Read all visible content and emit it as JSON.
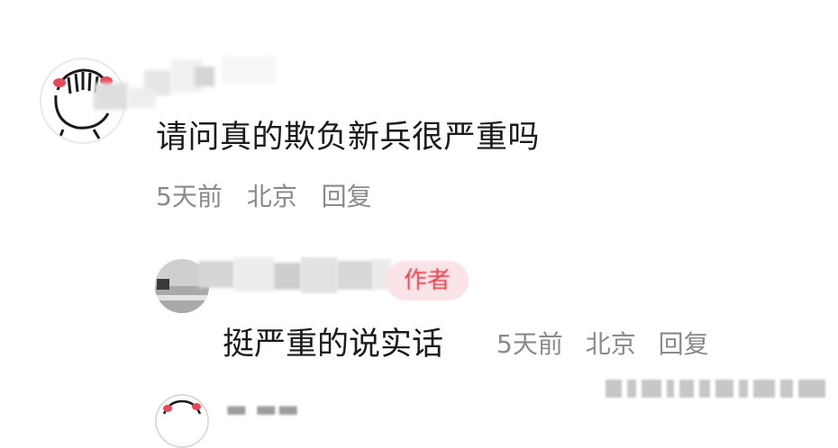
{
  "comment": {
    "text": "请问真的欺负新兵很严重吗",
    "time": "5天前",
    "location": "北京",
    "reply_label": "回复"
  },
  "reply": {
    "text": "挺严重的说实话",
    "badge": "作者",
    "time": "5天前",
    "location": "北京",
    "reply_label": "回复"
  }
}
